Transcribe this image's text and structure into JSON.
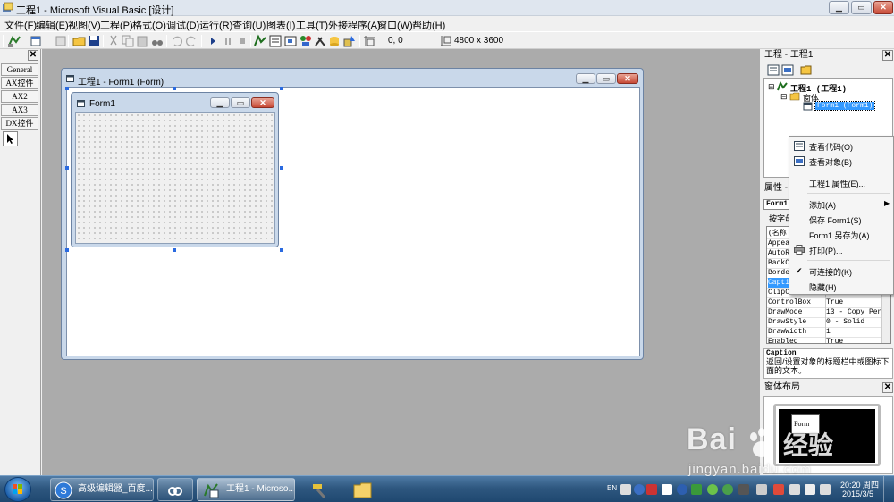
{
  "window": {
    "title": "工程1 - Microsoft Visual Basic [设计]",
    "controls": [
      "minimize",
      "maximize",
      "close"
    ]
  },
  "menu": [
    "文件(F)",
    "编辑(E)",
    "视图(V)",
    "工程(P)",
    "格式(O)",
    "调试(D)",
    "运行(R)",
    "查询(U)",
    "图表(I)",
    "工具(T)",
    "外接程序(A)",
    "窗口(W)",
    "帮助(H)"
  ],
  "toolbar": {
    "position_readout": "0, 0",
    "size_readout": "4800 x 3600"
  },
  "toolbox": {
    "tabs": [
      "General",
      "AX控件",
      "AX2",
      "AX3",
      "DX控件"
    ]
  },
  "form_window": {
    "title": "工程1 - Form1 (Form)",
    "form_caption": "Form1"
  },
  "project_explorer": {
    "title": "工程 - 工程1",
    "root": "工程1 (工程1)",
    "folder": "窗体",
    "item": "Form1 (Form1)"
  },
  "properties": {
    "header": "属性 -",
    "object": "Form1",
    "tab": "按字母",
    "rows": [
      {
        "name": "(名称",
        "value": ""
      },
      {
        "name": "Appea",
        "value": ""
      },
      {
        "name": "AutoR",
        "value": ""
      },
      {
        "name": "BackC",
        "value": ""
      },
      {
        "name": "Borde",
        "value": ""
      },
      {
        "name": "Capti",
        "value": "",
        "selected": true
      },
      {
        "name": "ClipC",
        "value": ""
      },
      {
        "name": "ControlBox",
        "value": "True"
      },
      {
        "name": "DrawMode",
        "value": "13 - Copy Pen"
      },
      {
        "name": "DrawStyle",
        "value": "0 - Solid"
      },
      {
        "name": "DrawWidth",
        "value": "1"
      },
      {
        "name": "Enabled",
        "value": "True"
      }
    ],
    "desc_title": "Caption",
    "desc_text": "返回/设置对象的标题栏中或图标下面的文本。"
  },
  "form_layout": {
    "title": "窗体布局",
    "form_label": "Form"
  },
  "context_menu": {
    "items": [
      {
        "label": "查看代码(O)",
        "icon": "code-icon"
      },
      {
        "label": "查看对象(B)",
        "icon": "object-icon"
      },
      {
        "sep": true
      },
      {
        "label": "工程1 属性(E)..."
      },
      {
        "sep": true
      },
      {
        "label": "添加(A)",
        "submenu": true
      },
      {
        "label": "保存 Form1(S)"
      },
      {
        "label": "Form1 另存为(A)..."
      },
      {
        "label": "打印(P)...",
        "icon": "printer-icon"
      },
      {
        "sep": true
      },
      {
        "label": "可连接的(K)",
        "checked": true
      },
      {
        "label": "隐藏(H)"
      }
    ]
  },
  "taskbar": {
    "tasks": [
      {
        "label": "高级编辑器_百度...",
        "icon": "sogou-icon"
      },
      {
        "label": "",
        "icon": "baidu-cloud-icon"
      },
      {
        "label": "工程1 - Microso...",
        "icon": "vb6-icon",
        "active": true
      },
      {
        "label": "",
        "icon": "tools-icon"
      },
      {
        "label": "",
        "icon": "folder-icon"
      }
    ],
    "tray_lang": "EN",
    "clock_time": "20:20 周四",
    "clock_date": "2015/3/5"
  },
  "watermark": {
    "brand": "Bai",
    "brand2": "经验",
    "url": "jingyan.baidu.com"
  },
  "colors": {
    "mdi_background": "#ababab",
    "selection": "#3399ff",
    "taskbar": "#2f5880"
  }
}
